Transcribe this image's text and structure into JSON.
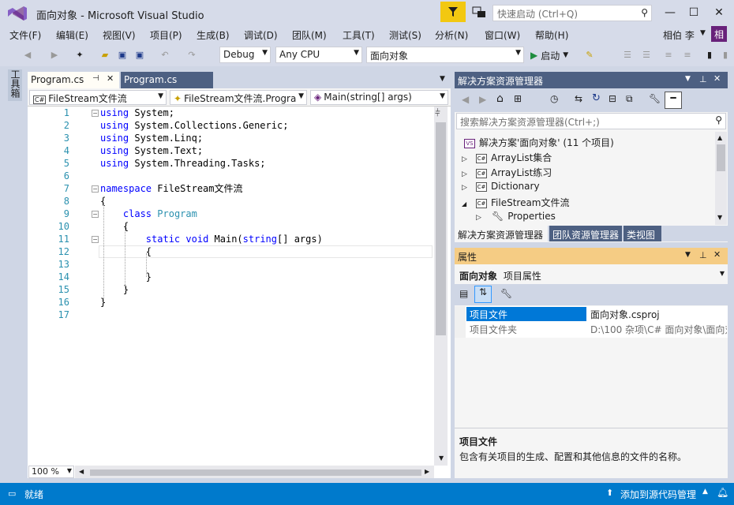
{
  "window": {
    "title": "面向对象 - Microsoft Visual Studio",
    "quick_launch_placeholder": "快速启动 (Ctrl+Q)",
    "controls": {
      "minimize": "—",
      "maximize": "☐",
      "close": "✕"
    }
  },
  "menu": [
    "文件(F)",
    "编辑(E)",
    "视图(V)",
    "项目(P)",
    "生成(B)",
    "调试(D)",
    "团队(M)",
    "工具(T)",
    "测试(S)",
    "分析(N)",
    "窗口(W)",
    "帮助(H)"
  ],
  "user": {
    "name": "相伯 李",
    "avatar_text": "相"
  },
  "toolbar": {
    "config": "Debug",
    "platform": "Any CPU",
    "project": "面向对象",
    "start_label": "启动"
  },
  "toolbox_label": "工具箱",
  "editor": {
    "tabs": [
      {
        "label": "Program.cs",
        "active": true
      },
      {
        "label": "Program.cs",
        "active": false
      }
    ],
    "nav": {
      "project": "FileStream文件流",
      "type": "FileStream文件流.Progra",
      "member": "Main(string[] args)"
    },
    "line_numbers": [
      "1",
      "2",
      "3",
      "4",
      "5",
      "6",
      "7",
      "8",
      "9",
      "10",
      "11",
      "12",
      "13",
      "14",
      "15",
      "16",
      "17"
    ],
    "lines": [
      [
        {
          "k": "kw",
          "t": "using"
        },
        {
          "k": "",
          "t": " System;"
        }
      ],
      [
        {
          "k": "kw",
          "t": "using"
        },
        {
          "k": "",
          "t": " System.Collections.Generic;"
        }
      ],
      [
        {
          "k": "kw",
          "t": "using"
        },
        {
          "k": "",
          "t": " System.Linq;"
        }
      ],
      [
        {
          "k": "kw",
          "t": "using"
        },
        {
          "k": "",
          "t": " System.Text;"
        }
      ],
      [
        {
          "k": "kw",
          "t": "using"
        },
        {
          "k": "",
          "t": " System.Threading.Tasks;"
        }
      ],
      [],
      [
        {
          "k": "kw",
          "t": "namespace"
        },
        {
          "k": "",
          "t": " FileStream文件流"
        }
      ],
      [
        {
          "k": "",
          "t": "{"
        }
      ],
      [
        {
          "k": "",
          "t": "    "
        },
        {
          "k": "kw",
          "t": "class"
        },
        {
          "k": "",
          "t": " "
        },
        {
          "k": "ty",
          "t": "Program"
        }
      ],
      [
        {
          "k": "",
          "t": "    {"
        }
      ],
      [
        {
          "k": "",
          "t": "        "
        },
        {
          "k": "kw",
          "t": "static"
        },
        {
          "k": "",
          "t": " "
        },
        {
          "k": "kw",
          "t": "void"
        },
        {
          "k": "",
          "t": " Main("
        },
        {
          "k": "kw",
          "t": "string"
        },
        {
          "k": "",
          "t": "[] args)"
        }
      ],
      [
        {
          "k": "",
          "t": "        {"
        }
      ],
      [],
      [
        {
          "k": "",
          "t": "        }"
        }
      ],
      [
        {
          "k": "",
          "t": "    }"
        }
      ],
      [
        {
          "k": "",
          "t": "}"
        }
      ],
      []
    ],
    "zoom": "100 %"
  },
  "solution_explorer": {
    "title": "解决方案资源管理器",
    "search_placeholder": "搜索解决方案资源管理器(Ctrl+;)",
    "items": [
      {
        "label": "解决方案'面向对象' (11 个项目)",
        "icon": "solution-icon",
        "expander": ""
      },
      {
        "label": "ArrayList集合",
        "icon": "csharp-project-icon",
        "expander": "▷"
      },
      {
        "label": "ArrayList练习",
        "icon": "csharp-project-icon",
        "expander": "▷"
      },
      {
        "label": "Dictionary",
        "icon": "csharp-project-icon",
        "expander": "▷"
      },
      {
        "label": "FileStream文件流",
        "icon": "csharp-project-icon",
        "expander": "◢"
      },
      {
        "label": "Properties",
        "icon": "wrench-icon",
        "expander": "▷"
      }
    ],
    "tabs": [
      "解决方案资源管理器",
      "团队资源管理器",
      "类视图"
    ]
  },
  "properties": {
    "title": "属性",
    "object": "面向对象",
    "object_type": "项目属性",
    "rows": [
      {
        "name": "项目文件",
        "value": "面向对象.csproj"
      },
      {
        "name": "项目文件夹",
        "value": "D:\\100 杂项\\C# 面向对象\\面向对"
      }
    ],
    "desc_title": "项目文件",
    "desc_text": "包含有关项目的生成、配置和其他信息的文件的名称。"
  },
  "status": {
    "ready": "就绪",
    "source_control": "添加到源代码管理"
  },
  "colors": {
    "accent": "#007acc",
    "tab_active_bg": "#fffdf6",
    "tab_inactive_bg": "#4d6082",
    "keyword": "#0000ff",
    "type": "#2b91af",
    "selection": "#0078d7"
  }
}
